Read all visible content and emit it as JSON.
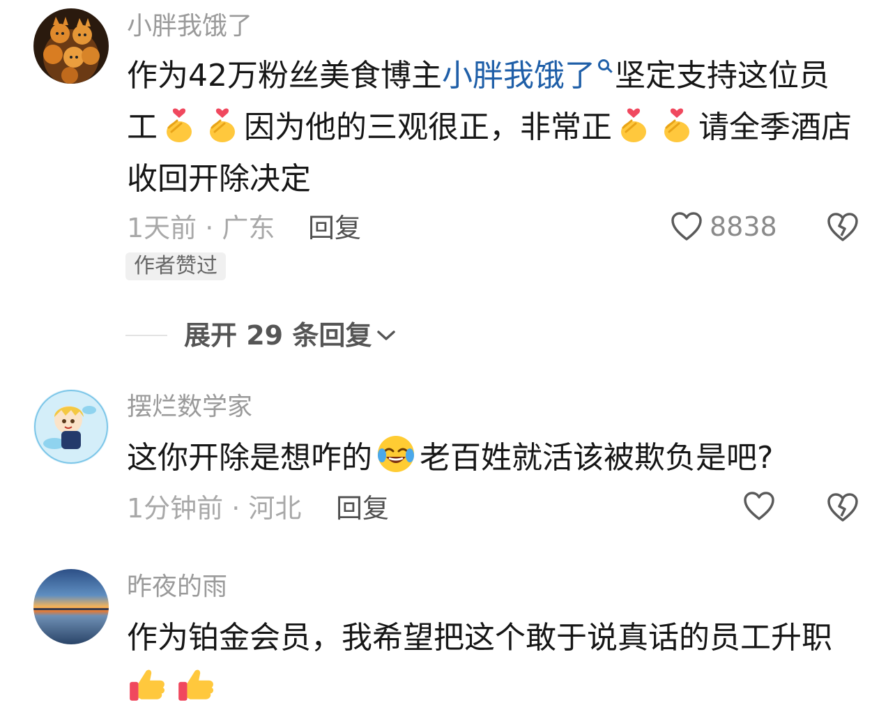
{
  "comments": [
    {
      "username": "小胖我饿了",
      "text_before": "作为42万粉丝美食博主",
      "mention": "小胖我饿了",
      "text_after_1": "坚定支持这位员工",
      "text_after_2": "因为他的三观很正，非常正",
      "text_after_3": "请全季酒店收回开除决定",
      "time_location": "1天前 · 广东",
      "reply_label": "回复",
      "like_count": "8838",
      "badge": "作者赞过",
      "expand_label": "展开 29 条回复"
    },
    {
      "username": "摆烂数学家",
      "text_before": "这你开除是想咋的",
      "text_after": "老百姓就活该被欺负是吧?",
      "time_location": "1分钟前 · 河北",
      "reply_label": "回复"
    },
    {
      "username": "昨夜的雨",
      "text": "作为铂金会员，我希望把这个敢于说真话的员工升职"
    }
  ],
  "colors": {
    "username": "#9a9a9a",
    "text": "#161616",
    "mention": "#1f5fa8",
    "meta": "#a8a8a8"
  },
  "icons": [
    "heart-icon",
    "broken-heart-icon",
    "chevron-down-icon",
    "finger-heart-emoji",
    "laughing-crying-emoji",
    "thumbs-up-emoji",
    "search-icon"
  ]
}
